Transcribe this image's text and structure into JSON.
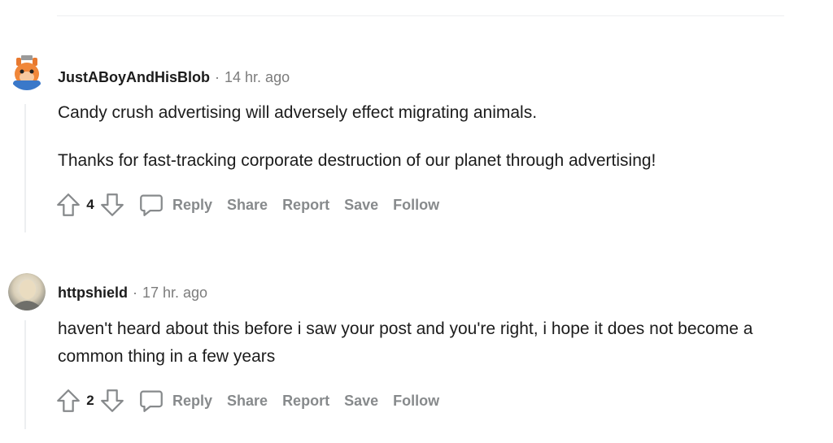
{
  "comments": [
    {
      "author": "JustABoyAndHisBlob",
      "time": "14 hr. ago",
      "paragraphs": [
        "Candy crush advertising will adversely effect migrating animals.",
        "Thanks for fast-tracking corporate destruction of our planet through advertising!"
      ],
      "score": "4"
    },
    {
      "author": "httpshield",
      "time": "17 hr. ago",
      "paragraphs": [
        "haven't heard about this before i saw your post and you're right, i hope it does not become a common thing in a few years"
      ],
      "score": "2"
    }
  ],
  "actions": {
    "reply": "Reply",
    "share": "Share",
    "report": "Report",
    "save": "Save",
    "follow": "Follow"
  },
  "separator": "·",
  "colors": {
    "meta": "#7c7c7c",
    "action": "#878a8c",
    "thread_line": "#edeff1"
  },
  "icons": [
    "upvote-arrow-icon",
    "downvote-arrow-icon",
    "comment-bubble-icon"
  ]
}
